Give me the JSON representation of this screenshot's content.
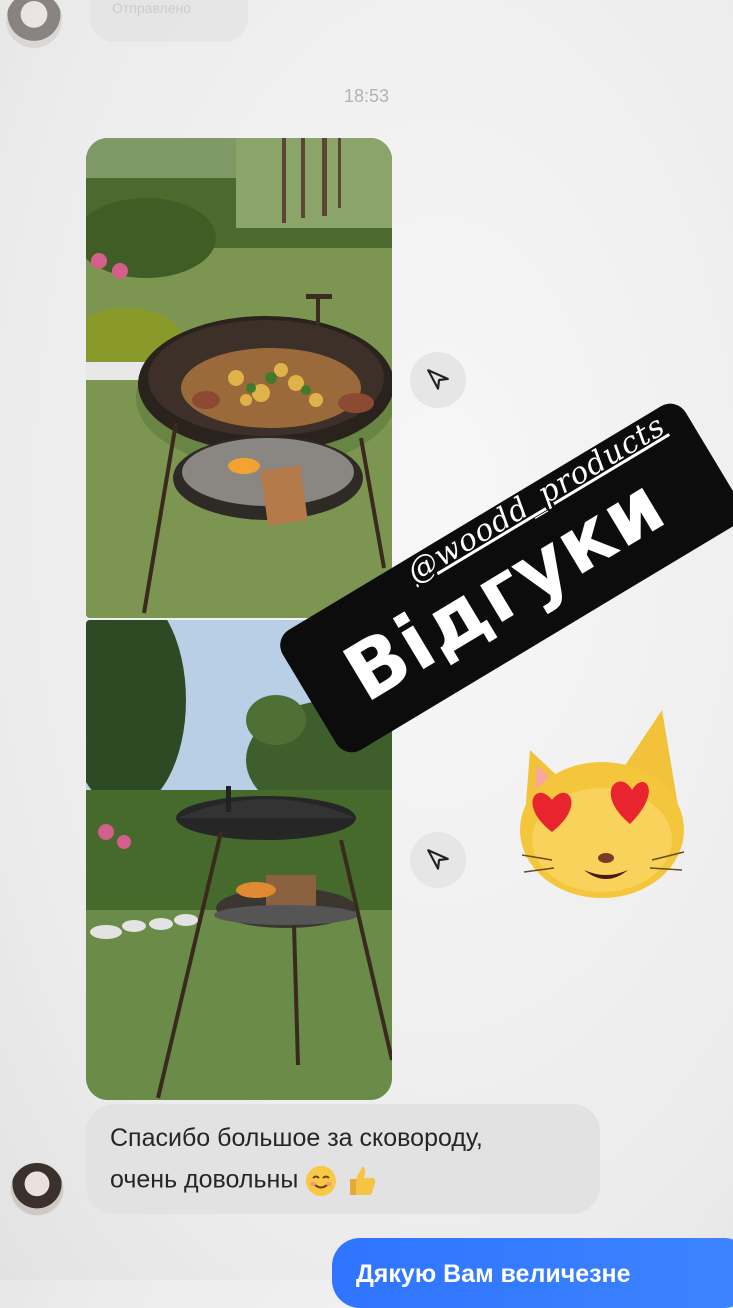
{
  "previous_message": {
    "text": "Отправлено"
  },
  "timestamp": "18:53",
  "sticker": {
    "handle": "@woodd_products",
    "title": "Відгуки"
  },
  "incoming_message": {
    "line1": "Спасибо большое за сковороду,",
    "line2": "очень довольны"
  },
  "outgoing_message": {
    "text": "Дякую Вам величезне"
  },
  "icons": [
    "share-icon",
    "smiling-face-emoji",
    "thumbs-up-emoji",
    "heart-eyes-cat-sticker"
  ]
}
